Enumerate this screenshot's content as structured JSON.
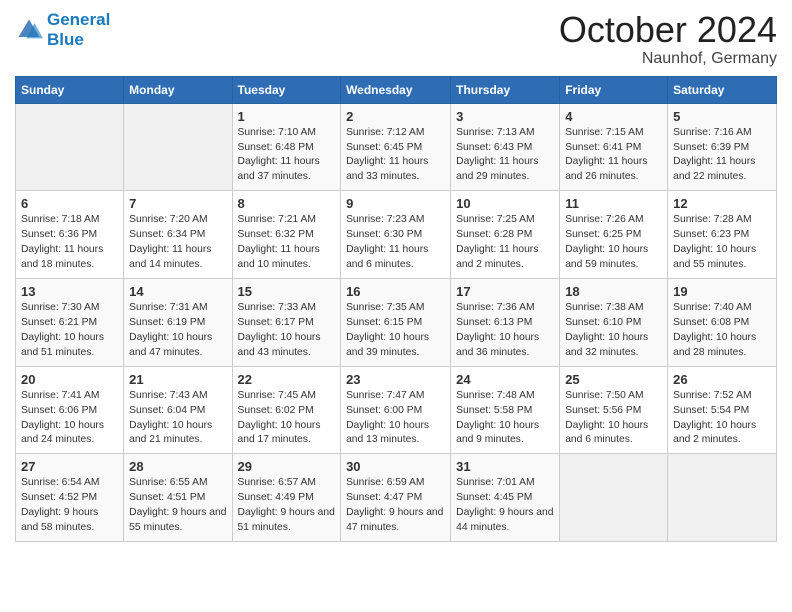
{
  "header": {
    "logo_line1": "General",
    "logo_line2": "Blue",
    "month": "October 2024",
    "location": "Naunhof, Germany"
  },
  "days_of_week": [
    "Sunday",
    "Monday",
    "Tuesday",
    "Wednesday",
    "Thursday",
    "Friday",
    "Saturday"
  ],
  "weeks": [
    [
      {
        "day": "",
        "content": ""
      },
      {
        "day": "",
        "content": ""
      },
      {
        "day": "1",
        "content": "Sunrise: 7:10 AM\nSunset: 6:48 PM\nDaylight: 11 hours and 37 minutes."
      },
      {
        "day": "2",
        "content": "Sunrise: 7:12 AM\nSunset: 6:45 PM\nDaylight: 11 hours and 33 minutes."
      },
      {
        "day": "3",
        "content": "Sunrise: 7:13 AM\nSunset: 6:43 PM\nDaylight: 11 hours and 29 minutes."
      },
      {
        "day": "4",
        "content": "Sunrise: 7:15 AM\nSunset: 6:41 PM\nDaylight: 11 hours and 26 minutes."
      },
      {
        "day": "5",
        "content": "Sunrise: 7:16 AM\nSunset: 6:39 PM\nDaylight: 11 hours and 22 minutes."
      }
    ],
    [
      {
        "day": "6",
        "content": "Sunrise: 7:18 AM\nSunset: 6:36 PM\nDaylight: 11 hours and 18 minutes."
      },
      {
        "day": "7",
        "content": "Sunrise: 7:20 AM\nSunset: 6:34 PM\nDaylight: 11 hours and 14 minutes."
      },
      {
        "day": "8",
        "content": "Sunrise: 7:21 AM\nSunset: 6:32 PM\nDaylight: 11 hours and 10 minutes."
      },
      {
        "day": "9",
        "content": "Sunrise: 7:23 AM\nSunset: 6:30 PM\nDaylight: 11 hours and 6 minutes."
      },
      {
        "day": "10",
        "content": "Sunrise: 7:25 AM\nSunset: 6:28 PM\nDaylight: 11 hours and 2 minutes."
      },
      {
        "day": "11",
        "content": "Sunrise: 7:26 AM\nSunset: 6:25 PM\nDaylight: 10 hours and 59 minutes."
      },
      {
        "day": "12",
        "content": "Sunrise: 7:28 AM\nSunset: 6:23 PM\nDaylight: 10 hours and 55 minutes."
      }
    ],
    [
      {
        "day": "13",
        "content": "Sunrise: 7:30 AM\nSunset: 6:21 PM\nDaylight: 10 hours and 51 minutes."
      },
      {
        "day": "14",
        "content": "Sunrise: 7:31 AM\nSunset: 6:19 PM\nDaylight: 10 hours and 47 minutes."
      },
      {
        "day": "15",
        "content": "Sunrise: 7:33 AM\nSunset: 6:17 PM\nDaylight: 10 hours and 43 minutes."
      },
      {
        "day": "16",
        "content": "Sunrise: 7:35 AM\nSunset: 6:15 PM\nDaylight: 10 hours and 39 minutes."
      },
      {
        "day": "17",
        "content": "Sunrise: 7:36 AM\nSunset: 6:13 PM\nDaylight: 10 hours and 36 minutes."
      },
      {
        "day": "18",
        "content": "Sunrise: 7:38 AM\nSunset: 6:10 PM\nDaylight: 10 hours and 32 minutes."
      },
      {
        "day": "19",
        "content": "Sunrise: 7:40 AM\nSunset: 6:08 PM\nDaylight: 10 hours and 28 minutes."
      }
    ],
    [
      {
        "day": "20",
        "content": "Sunrise: 7:41 AM\nSunset: 6:06 PM\nDaylight: 10 hours and 24 minutes."
      },
      {
        "day": "21",
        "content": "Sunrise: 7:43 AM\nSunset: 6:04 PM\nDaylight: 10 hours and 21 minutes."
      },
      {
        "day": "22",
        "content": "Sunrise: 7:45 AM\nSunset: 6:02 PM\nDaylight: 10 hours and 17 minutes."
      },
      {
        "day": "23",
        "content": "Sunrise: 7:47 AM\nSunset: 6:00 PM\nDaylight: 10 hours and 13 minutes."
      },
      {
        "day": "24",
        "content": "Sunrise: 7:48 AM\nSunset: 5:58 PM\nDaylight: 10 hours and 9 minutes."
      },
      {
        "day": "25",
        "content": "Sunrise: 7:50 AM\nSunset: 5:56 PM\nDaylight: 10 hours and 6 minutes."
      },
      {
        "day": "26",
        "content": "Sunrise: 7:52 AM\nSunset: 5:54 PM\nDaylight: 10 hours and 2 minutes."
      }
    ],
    [
      {
        "day": "27",
        "content": "Sunrise: 6:54 AM\nSunset: 4:52 PM\nDaylight: 9 hours and 58 minutes."
      },
      {
        "day": "28",
        "content": "Sunrise: 6:55 AM\nSunset: 4:51 PM\nDaylight: 9 hours and 55 minutes."
      },
      {
        "day": "29",
        "content": "Sunrise: 6:57 AM\nSunset: 4:49 PM\nDaylight: 9 hours and 51 minutes."
      },
      {
        "day": "30",
        "content": "Sunrise: 6:59 AM\nSunset: 4:47 PM\nDaylight: 9 hours and 47 minutes."
      },
      {
        "day": "31",
        "content": "Sunrise: 7:01 AM\nSunset: 4:45 PM\nDaylight: 9 hours and 44 minutes."
      },
      {
        "day": "",
        "content": ""
      },
      {
        "day": "",
        "content": ""
      }
    ]
  ]
}
